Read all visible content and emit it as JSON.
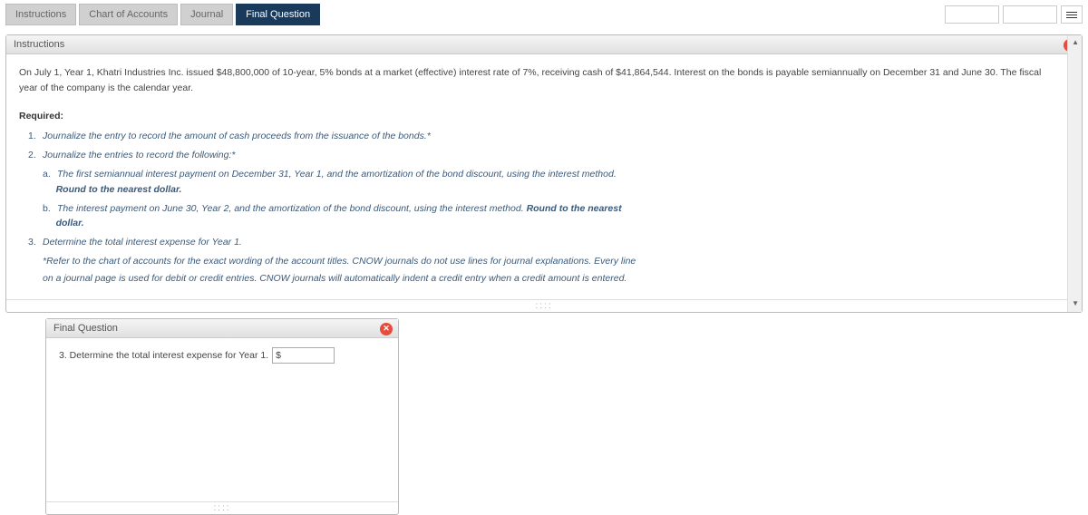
{
  "tabs": {
    "instructions": "Instructions",
    "chart": "Chart of Accounts",
    "journal": "Journal",
    "final": "Final Question"
  },
  "instructions_panel": {
    "title": "Instructions",
    "intro": "On July 1, Year 1, Khatri Industries Inc. issued $48,800,000 of 10-year, 5% bonds at a market (effective) interest rate of 7%, receiving cash of $41,864,544. Interest on the bonds is payable semiannually on December 31 and June 30. The fiscal year of the company is the calendar year.",
    "required_label": "Required:",
    "items": {
      "i1": "Journalize the entry to record the amount of cash proceeds from the issuance of the bonds.*",
      "i2": "Journalize the entries to record the following:*",
      "i2a": "The first semiannual interest payment on December 31, Year 1, and the amortization of the bond discount, using the interest method.",
      "i2a_bold": "Round to the nearest dollar.",
      "i2b_pre": "The interest payment on June 30, Year 2, and the amortization of the bond discount, using the interest method. ",
      "i2b_bold": "Round to the nearest",
      "i2b_post": "dollar.",
      "i3": "Determine the total interest expense for Year 1.",
      "note1": "*Refer to the chart of accounts for the exact wording of the account titles. CNOW journals do not use lines for journal explanations. Every line",
      "note2": "on a journal page is used for debit or credit entries. CNOW journals will automatically indent a credit entry when a credit amount is entered."
    }
  },
  "final_panel": {
    "title": "Final Question",
    "prompt": "3. Determine the total interest expense for Year 1.",
    "currency": "$",
    "value": ""
  }
}
